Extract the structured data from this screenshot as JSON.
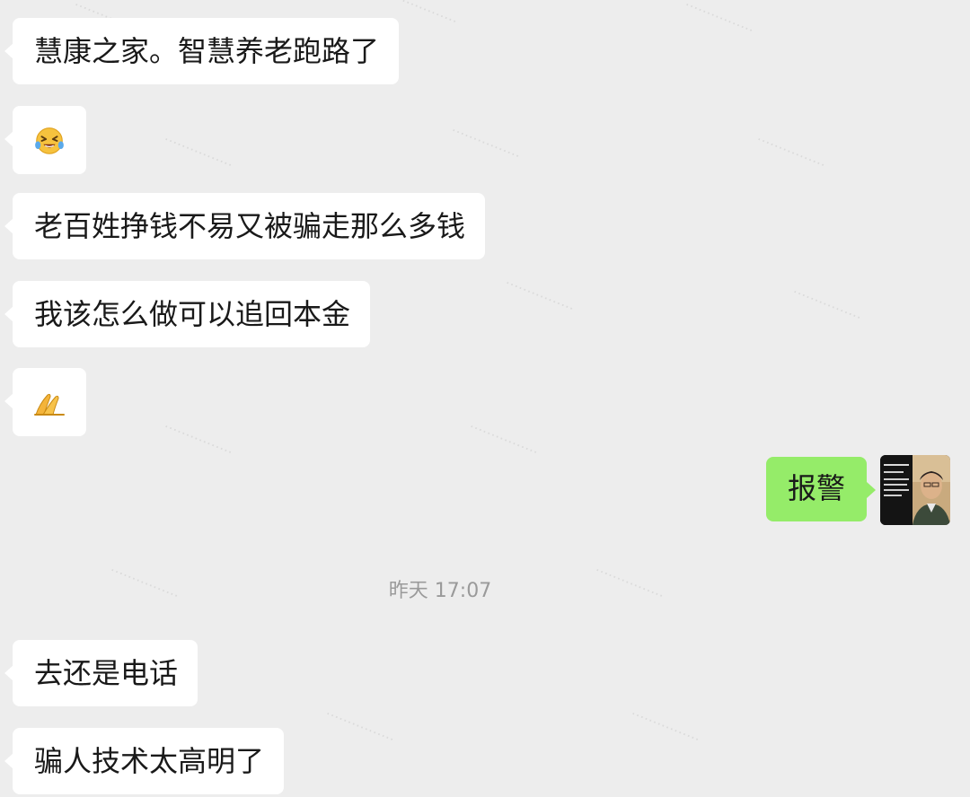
{
  "messages": {
    "m1": "慧康之家。智慧养老跑路了",
    "m3": "老百姓挣钱不易又被骗走那么多钱",
    "m4": "我该怎么做可以追回本金",
    "sent": "报警",
    "m6": "去还是电话",
    "m7": "骗人技术太高明了"
  },
  "emojis": {
    "crying": "crying-laughing-face-icon",
    "pray": "folded-hands-icon"
  },
  "timestamp": "昨天 17:07",
  "colors": {
    "background": "#ededed",
    "incoming_bubble": "#ffffff",
    "outgoing_bubble": "#95ec69",
    "timestamp": "#9a9a9a"
  }
}
